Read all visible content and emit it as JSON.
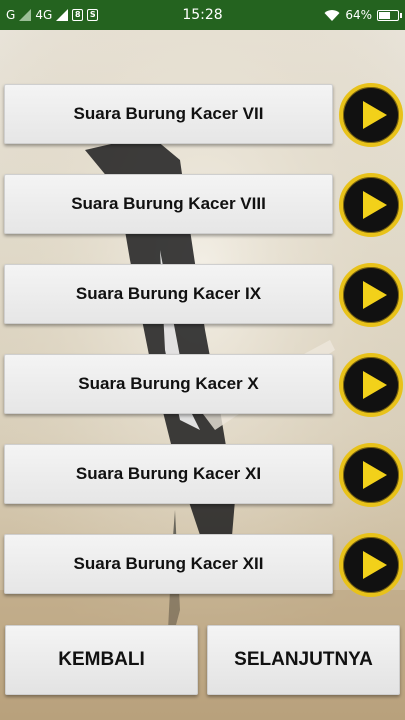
{
  "status_bar": {
    "carrier_left": "G",
    "network": "4G",
    "time": "15:28",
    "battery_percent": "64%",
    "battery_level": 0.64,
    "icons": [
      "signal-icon",
      "sim-icon",
      "notification-icon",
      "wifi-icon",
      "battery-icon"
    ]
  },
  "tracks": [
    {
      "label": "Suara Burung Kacer VII"
    },
    {
      "label": "Suara Burung Kacer VIII"
    },
    {
      "label": "Suara Burung Kacer IX"
    },
    {
      "label": "Suara Burung Kacer X"
    },
    {
      "label": "Suara Burung Kacer XI"
    },
    {
      "label": "Suara Burung Kacer XII"
    }
  ],
  "footer": {
    "back_label": "KEMBALI",
    "next_label": "SELANJUTNYA"
  },
  "colors": {
    "status_bar": "#24631f",
    "play_ring": "#e8c21a",
    "play_triangle": "#f2d11a"
  }
}
